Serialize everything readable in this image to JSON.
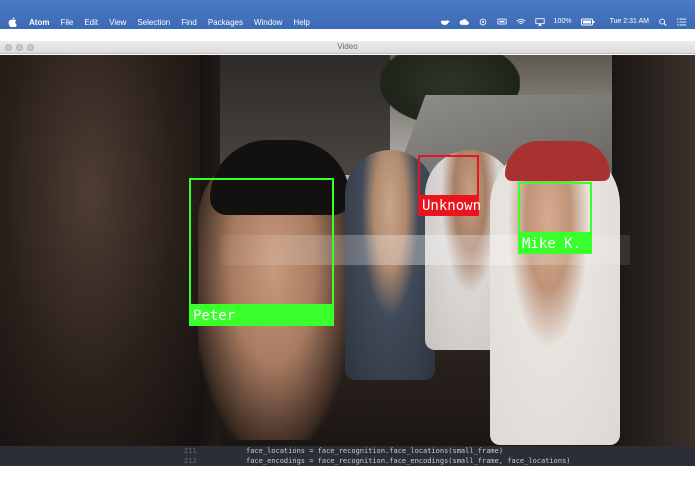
{
  "menubar": {
    "app_name": "Atom",
    "items": [
      "File",
      "Edit",
      "View",
      "Selection",
      "Find",
      "Packages",
      "Window",
      "Help"
    ],
    "battery": "100%",
    "clock": "Tue 2:31 AM"
  },
  "window": {
    "title": "Video"
  },
  "faces": [
    {
      "label": "Peter",
      "color": "#39ff2b"
    },
    {
      "label": "Unknown",
      "color": "#e8141e"
    },
    {
      "label": "Mike K.",
      "color": "#39ff2b"
    }
  ],
  "editor": {
    "lines": [
      {
        "number": "211",
        "code": "face_locations = face_recognition.face_locations(small_frame)"
      },
      {
        "number": "212",
        "code": "face_encodings = face_recognition.face_encodings(small_frame, face_locations)"
      }
    ]
  }
}
